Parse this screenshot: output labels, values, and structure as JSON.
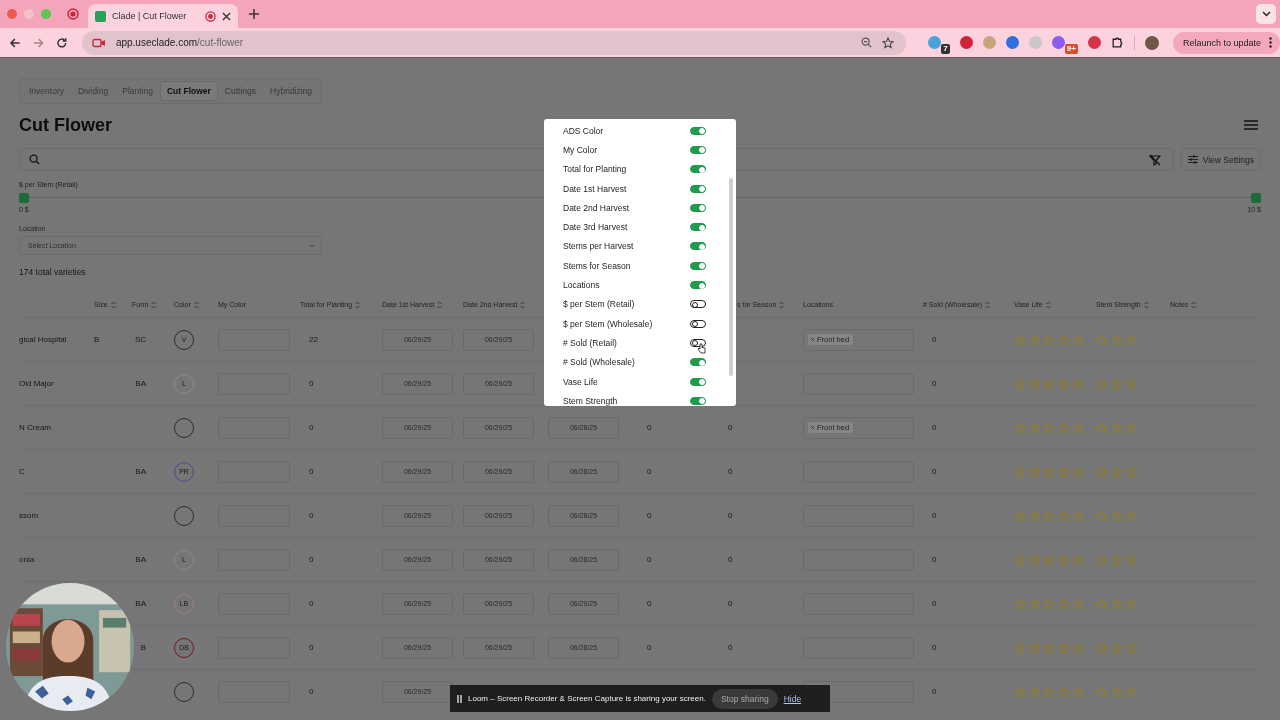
{
  "browser": {
    "tab_title": "Clade | Cut Flower",
    "url_host": "app.useclade.com",
    "url_path": "/cut-flower",
    "extension_badges": [
      "7",
      "9+"
    ],
    "relaunch": "Relaunch to update"
  },
  "nav_tabs": [
    {
      "label": "Inventory",
      "selected": false
    },
    {
      "label": "Dividing",
      "selected": false
    },
    {
      "label": "Planting",
      "selected": false
    },
    {
      "label": "Cut Flower",
      "selected": true
    },
    {
      "label": "Cuttings",
      "selected": false
    },
    {
      "label": "Hybridizing",
      "selected": false
    }
  ],
  "title": "Cut Flower",
  "view_settings": "View Settings",
  "price_filter": {
    "label": "$ per Stem (Retail)",
    "thumbs": [
      {
        "level": 0
      },
      {
        "level": 1
      }
    ],
    "min": "0 $",
    "max": "10 $"
  },
  "location_filter": {
    "label": "Location",
    "placeholder": "Select Location"
  },
  "total": "174 total varieties",
  "table": {
    "columns": [
      {},
      {
        "label": "Size",
        "sortable": true
      },
      {
        "label": "Form",
        "sortable": true
      },
      {
        "label": "Color",
        "sortable": true
      },
      {
        "label": "My Color",
        "sortable": false
      },
      {
        "label": "Total for Planting",
        "sortable": true
      },
      {
        "label": "Date 1st Harvest",
        "sortable": true
      },
      {
        "label": "Date 2nd Harvest",
        "sortable": true
      },
      {},
      {},
      {
        "label": "s for Season",
        "sortable": true
      },
      {
        "label": "Locations",
        "sortable": false
      },
      {
        "label": "# Sold (Wholesale)",
        "sortable": true
      },
      {
        "label": "Vase Life",
        "sortable": true
      },
      {
        "label": "Stem Strength",
        "sortable": true
      },
      {
        "label": "Notes",
        "sortable": true
      }
    ],
    "rows": [
      {
        "name": "gical Hospital",
        "size": "B",
        "form": "SC",
        "color_badge": {
          "text": "V",
          "color": "#2e2e2e"
        },
        "total": "22",
        "date1": "06/29/25",
        "date2": "06/29/25",
        "location_tag": "Front bed",
        "sold_wholesale": "0",
        "vase_life": {
          "stars": 0
        },
        "stem_strength": {
          "stars": 0
        }
      },
      {
        "name": "Old Major",
        "form": "BA",
        "color_badge": {
          "text": "L",
          "color": "#8e8e8e"
        },
        "total": "0",
        "date1": "06/29/25",
        "date2": "06/29/25",
        "sold_wholesale": "0",
        "vase_life": {
          "stars": 0
        },
        "stem_strength": {
          "stars": 0
        }
      },
      {
        "name": "N Cream",
        "color_badge": {
          "color": "#2e2e2e"
        },
        "total": "0",
        "date1": "06/29/25",
        "date2": "06/29/25",
        "date3": "06/28/25",
        "stems_per_harvest": "0",
        "stems_for_season": "0",
        "location_tag": "Front bed",
        "sold_wholesale": "0",
        "vase_life": {
          "stars": 0
        },
        "stem_strength": {
          "stars": 0
        }
      },
      {
        "name": "C",
        "form": "BA",
        "color_badge": {
          "text": "PR",
          "color": "#4a4a86"
        },
        "total": "0",
        "date1": "06/29/25",
        "date2": "06/29/25",
        "date3": "06/28/25",
        "stems_per_harvest": "0",
        "stems_for_season": "0",
        "sold_wholesale": "0",
        "vase_life": {
          "stars": 0
        },
        "stem_strength": {
          "stars": 0
        }
      },
      {
        "name": "ssom",
        "color_badge": {
          "color": "#2e2e2e"
        },
        "total": "0",
        "date1": "06/29/25",
        "date2": "06/29/25",
        "date3": "06/28/25",
        "stems_per_harvest": "0",
        "stems_for_season": "0",
        "sold_wholesale": "0",
        "vase_life": {
          "stars": 0
        },
        "stem_strength": {
          "stars": 0
        }
      },
      {
        "name": "onia",
        "form": "BA",
        "color_badge": {
          "text": "L",
          "color": "#8a8a9c"
        },
        "total": "0",
        "date1": "06/29/25",
        "date2": "06/29/25",
        "date3": "06/28/25",
        "stems_per_harvest": "0",
        "stems_for_season": "0",
        "sold_wholesale": "0",
        "vase_life": {
          "stars": 0
        },
        "stem_strength": {
          "stars": 0
        }
      },
      {
        "form": "BA",
        "color_badge": {
          "text": "LB",
          "color": "#a08282"
        },
        "total": "0",
        "date1": "06/29/25",
        "date2": "06/29/25",
        "date3": "06/29/25",
        "stems_per_harvest": "0",
        "stems_for_season": "0",
        "sold_wholesale": "0",
        "vase_life": {
          "stars": 0
        },
        "stem_strength": {
          "stars": 0
        }
      },
      {
        "form": "B",
        "color_badge": {
          "text": "DB",
          "color": "#6a1c1c"
        },
        "total": "0",
        "date1": "06/29/25",
        "date2": "06/29/25",
        "date3": "06/28/25",
        "stems_per_harvest": "0",
        "stems_for_season": "0",
        "sold_wholesale": "0",
        "vase_life": {
          "stars": 0
        },
        "stem_strength": {
          "stars": 0
        }
      },
      {
        "color_badge": {
          "color": "#2e2e2e"
        },
        "total": "0",
        "date1": "06/29/25",
        "sold_wholesale": "0",
        "vase_life": {
          "stars": 0
        },
        "stem_strength": {
          "stars": 0
        }
      }
    ]
  },
  "column_settings": [
    {
      "label": "ADS Color",
      "on": true
    },
    {
      "label": "My Color",
      "on": true
    },
    {
      "label": "Total for Planting",
      "on": true
    },
    {
      "label": "Date 1st Harvest",
      "on": true
    },
    {
      "label": "Date 2nd Harvest",
      "on": true
    },
    {
      "label": "Date 3rd Harvest",
      "on": true
    },
    {
      "label": "Stems per Harvest",
      "on": true
    },
    {
      "label": "Stems for Season",
      "on": true
    },
    {
      "label": "Locations",
      "on": true
    },
    {
      "label": "$ per Stem (Retail)",
      "on": false
    },
    {
      "label": "$ per Stem (Wholesale)",
      "on": false
    },
    {
      "label": "# Sold (Retail)",
      "on": false
    },
    {
      "label": "# Sold (Wholesale)",
      "on": true
    },
    {
      "label": "Vase Life",
      "on": true
    },
    {
      "label": "Stem Strength",
      "on": true
    }
  ],
  "loom": {
    "message": "Loom – Screen Recorder & Screen Capture is sharing your screen.",
    "stop": "Stop sharing",
    "hide": "Hide"
  }
}
